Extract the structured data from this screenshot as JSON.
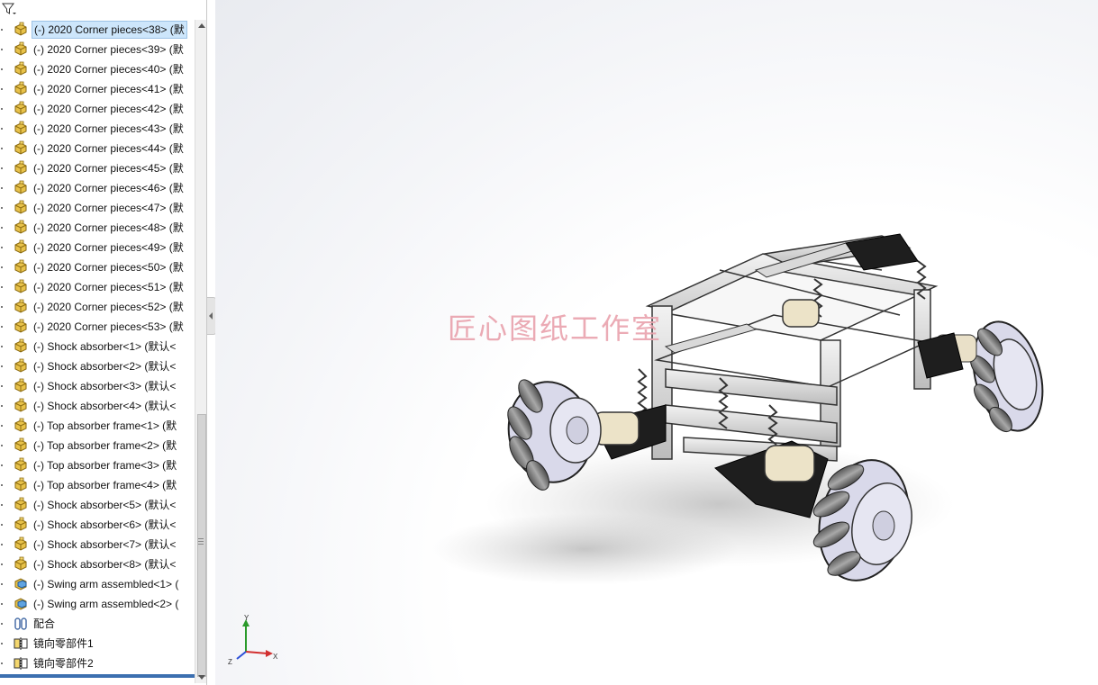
{
  "tree": {
    "items": [
      {
        "label": "(-) 2020 Corner pieces<38> (默",
        "icon": "part-icon",
        "selected": true
      },
      {
        "label": "(-) 2020 Corner pieces<39> (默",
        "icon": "part-icon"
      },
      {
        "label": "(-) 2020 Corner pieces<40> (默",
        "icon": "part-icon"
      },
      {
        "label": "(-) 2020 Corner pieces<41> (默",
        "icon": "part-icon"
      },
      {
        "label": "(-) 2020 Corner pieces<42> (默",
        "icon": "part-icon"
      },
      {
        "label": "(-) 2020 Corner pieces<43> (默",
        "icon": "part-icon"
      },
      {
        "label": "(-) 2020 Corner pieces<44> (默",
        "icon": "part-icon"
      },
      {
        "label": "(-) 2020 Corner pieces<45> (默",
        "icon": "part-icon"
      },
      {
        "label": "(-) 2020 Corner pieces<46> (默",
        "icon": "part-icon"
      },
      {
        "label": "(-) 2020 Corner pieces<47> (默",
        "icon": "part-icon"
      },
      {
        "label": "(-) 2020 Corner pieces<48> (默",
        "icon": "part-icon"
      },
      {
        "label": "(-) 2020 Corner pieces<49> (默",
        "icon": "part-icon"
      },
      {
        "label": "(-) 2020 Corner pieces<50> (默",
        "icon": "part-icon"
      },
      {
        "label": "(-) 2020 Corner pieces<51> (默",
        "icon": "part-icon"
      },
      {
        "label": "(-) 2020 Corner pieces<52> (默",
        "icon": "part-icon"
      },
      {
        "label": "(-) 2020 Corner pieces<53> (默",
        "icon": "part-icon"
      },
      {
        "label": "(-) Shock absorber<1> (默认<",
        "icon": "part-icon"
      },
      {
        "label": "(-) Shock absorber<2> (默认<",
        "icon": "part-icon"
      },
      {
        "label": "(-) Shock absorber<3> (默认<",
        "icon": "part-icon"
      },
      {
        "label": "(-) Shock absorber<4> (默认<",
        "icon": "part-icon"
      },
      {
        "label": "(-) Top absorber frame<1> (默",
        "icon": "part-icon"
      },
      {
        "label": "(-) Top absorber frame<2> (默",
        "icon": "part-icon"
      },
      {
        "label": "(-) Top absorber frame<3> (默",
        "icon": "part-icon"
      },
      {
        "label": "(-) Top absorber frame<4> (默",
        "icon": "part-icon"
      },
      {
        "label": "(-) Shock absorber<5> (默认<",
        "icon": "part-icon"
      },
      {
        "label": "(-) Shock absorber<6> (默认<",
        "icon": "part-icon"
      },
      {
        "label": "(-) Shock absorber<7> (默认<",
        "icon": "part-icon"
      },
      {
        "label": "(-) Shock absorber<8> (默认<",
        "icon": "part-icon"
      },
      {
        "label": "(-) Swing arm assembled<1> (",
        "icon": "assembly-icon"
      },
      {
        "label": "(-) Swing arm assembled<2> (",
        "icon": "assembly-icon"
      },
      {
        "label": "配合",
        "icon": "mates-icon"
      },
      {
        "label": "镜向零部件1",
        "icon": "mirror-component-icon"
      },
      {
        "label": "镜向零部件2",
        "icon": "mirror-component-icon"
      }
    ]
  },
  "viewport": {
    "watermark": "匠心图纸工作室",
    "triad": {
      "x": "X",
      "y": "Y",
      "z": "Z"
    }
  },
  "colors": {
    "selection": "#cde6fb",
    "watermark": "#e9a2ad",
    "part_yellow": "#e8c24a"
  }
}
